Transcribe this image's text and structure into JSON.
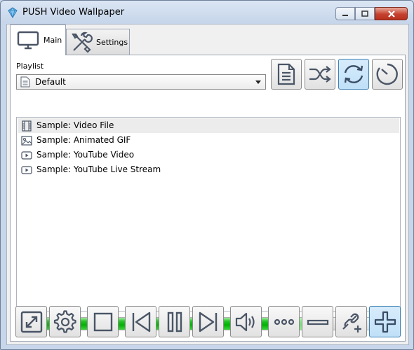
{
  "window": {
    "title": "PUSH Video Wallpaper"
  },
  "tabs": [
    {
      "label": "Main",
      "icon": "monitor-icon",
      "active": true
    },
    {
      "label": "Settings",
      "icon": "tools-icon",
      "active": false
    }
  ],
  "playlist": {
    "label": "Playlist",
    "selected": "Default",
    "icon": "document-icon"
  },
  "playlist_buttons": [
    {
      "icon": "playlist-document-icon",
      "active": false
    },
    {
      "icon": "shuffle-icon",
      "active": false
    },
    {
      "icon": "repeat-icon",
      "active": true
    },
    {
      "icon": "timer-icon",
      "active": false
    }
  ],
  "items": [
    {
      "label": "Sample: Video File",
      "icon": "film-icon",
      "selected": true
    },
    {
      "label": "Sample: Animated GIF",
      "icon": "image-icon",
      "selected": false
    },
    {
      "label": "Sample: YouTube Video",
      "icon": "youtube-icon",
      "selected": false
    },
    {
      "label": "Sample: YouTube Live Stream",
      "icon": "youtube-icon",
      "selected": false
    }
  ],
  "progress": {
    "value": 0.77
  },
  "controls": [
    {
      "icon": "fullscreen-icon"
    },
    {
      "icon": "gear-icon"
    },
    {
      "icon": "stop-icon"
    },
    {
      "icon": "previous-icon"
    },
    {
      "icon": "pause-icon"
    },
    {
      "icon": "next-icon"
    },
    {
      "icon": "volume-icon"
    },
    {
      "icon": "more-icon"
    },
    {
      "icon": "remove-icon"
    },
    {
      "icon": "add-url-icon"
    },
    {
      "icon": "add-icon"
    }
  ],
  "colors": {
    "accent": "#3c7fb1",
    "progress": "#06b006",
    "icon": "#4a5566"
  }
}
